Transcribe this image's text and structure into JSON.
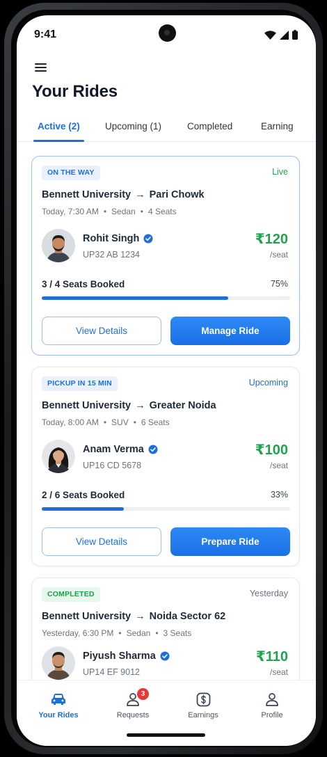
{
  "status_bar": {
    "time": "9:41"
  },
  "header": {
    "title": "Your Rides"
  },
  "tabs": [
    {
      "label": "Active (2)",
      "active": true
    },
    {
      "label": "Upcoming (1)"
    },
    {
      "label": "Completed"
    },
    {
      "label": "Earning"
    }
  ],
  "rides": [
    {
      "badge": "ON THE WAY",
      "status": "Live",
      "from": "Bennett University",
      "arrow": "→",
      "to": "Pari Chowk",
      "time": "Today, 7:30 AM",
      "vehicle": "Sedan",
      "seats": "4 Seats",
      "dot": "•",
      "driver": "Rohit Singh",
      "plate": "UP32 AB 1234",
      "price": "₹120",
      "per": "/seat",
      "seats_booked": "3 / 4 Seats Booked",
      "pct_label": "75%",
      "progress": 0.75,
      "btn_secondary": "View Details",
      "btn_primary": "Manage Ride"
    },
    {
      "badge": "PICKUP IN 15 MIN",
      "status": "Upcoming",
      "from": "Bennett University",
      "arrow": "→",
      "to": "Greater Noida",
      "time": "Today, 8:00 AM",
      "vehicle": "SUV",
      "seats": "6 Seats",
      "dot": "•",
      "driver": "Anam Verma",
      "plate": "UP16 CD 5678",
      "price": "₹100",
      "per": "/seat",
      "seats_booked": "2 / 6 Seats Booked",
      "pct_label": "33%",
      "progress": 0.33,
      "btn_secondary": "View Details",
      "btn_primary": "Prepare Ride"
    },
    {
      "badge": "COMPLETED",
      "status": "Yesterday",
      "from": "Bennett University",
      "arrow": "→",
      "to": "Noida Sector 62",
      "time": "Yesterday, 6:30 PM",
      "vehicle": "Sedan",
      "seats": "3 Seats",
      "dot": "•",
      "driver": "Piyush Sharma",
      "plate": "UP14 EF 9012",
      "price": "₹110",
      "per": "/seat"
    }
  ],
  "bottom_nav": [
    {
      "label": "Your Rides",
      "icon": "car-icon",
      "active": true
    },
    {
      "label": "Requests",
      "icon": "user-icon",
      "badge": "3"
    },
    {
      "label": "Earnings",
      "icon": "dollar-icon"
    },
    {
      "label": "Profile",
      "icon": "profile-icon"
    }
  ],
  "colors": {
    "accent": "#1e6fd9",
    "price": "#1fa34c",
    "live": "#22a34f",
    "badge_red": "#e53935"
  }
}
